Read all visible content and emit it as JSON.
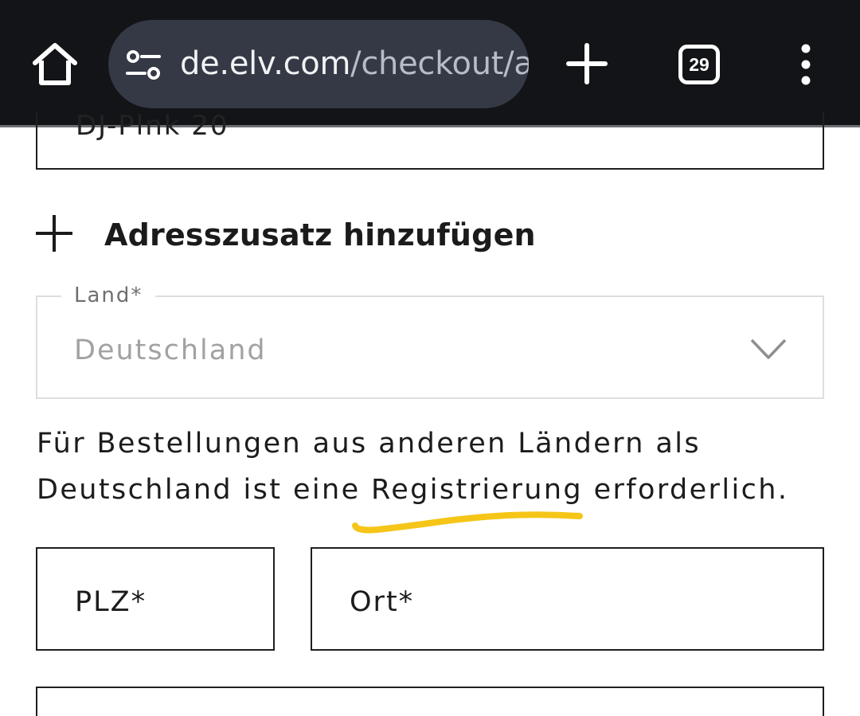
{
  "browser": {
    "url_host": "de.elv.com",
    "url_path": "/checkout/a",
    "tab_count": "29"
  },
  "form": {
    "prev_field_clipped": "DJ-Plnk 20",
    "address_addition_label": "Adresszusatz hinzufügen",
    "country_label": "Land*",
    "country_value": "Deutschland",
    "info_line1": "Für Bestellungen aus anderen Ländern als",
    "info_line2": "Deutschland ist eine Registrierung erforderlich.",
    "postal_code_placeholder": "PLZ*",
    "city_placeholder": "Ort*"
  },
  "colors": {
    "chrome_bg": "#131417",
    "url_pill": "#353945",
    "highlight": "#f5c518"
  },
  "icons": {
    "home": "home-icon",
    "site_settings": "tune-icon",
    "new_tab": "plus-icon",
    "tab_switcher": "tab-counter-icon",
    "menu": "more-vertical-icon",
    "add_address": "plus-icon",
    "dropdown": "chevron-down-icon"
  }
}
